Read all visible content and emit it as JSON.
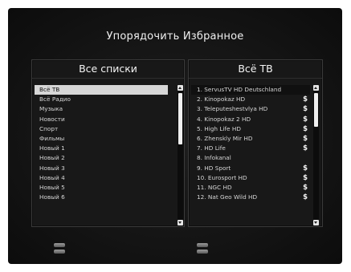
{
  "title": "Упорядочить Избранное",
  "left_panel": {
    "header": "Все списки",
    "items": [
      "Всё ТВ",
      "Всё Радио",
      "Музыка",
      "Новости",
      "Спорт",
      "Фильмы",
      "Новый 1",
      "Новый 2",
      "Новый 3",
      "Новый 4",
      "Новый 5",
      "Новый 6"
    ],
    "selected_index": 0
  },
  "right_panel": {
    "header": "Всё ТВ",
    "channels": [
      {
        "label": "1.  ServusTV HD Deutschland",
        "scrambled": ""
      },
      {
        "label": "2.  Kinopokaz HD",
        "scrambled": "$"
      },
      {
        "label": "3.  Teleputeshestvlya HD",
        "scrambled": "$"
      },
      {
        "label": "4.  Kinopokaz 2 HD",
        "scrambled": "$"
      },
      {
        "label": "5.  High Life HD",
        "scrambled": "$"
      },
      {
        "label": "6.  Zhenskly Mir HD",
        "scrambled": "$"
      },
      {
        "label": "7.  HD Life",
        "scrambled": "$"
      },
      {
        "label": "8.  Infokanal",
        "scrambled": ""
      },
      {
        "label": "9.  HD Sport",
        "scrambled": "$"
      },
      {
        "label": "10. Eurosport HD",
        "scrambled": "$"
      },
      {
        "label": "11. NGC HD",
        "scrambled": "$"
      },
      {
        "label": "12. Nat Geo Wild HD",
        "scrambled": "$"
      }
    ]
  },
  "footer": {
    "button1_icon": "double-bar-icon",
    "button2_icon": "double-bar-icon"
  }
}
